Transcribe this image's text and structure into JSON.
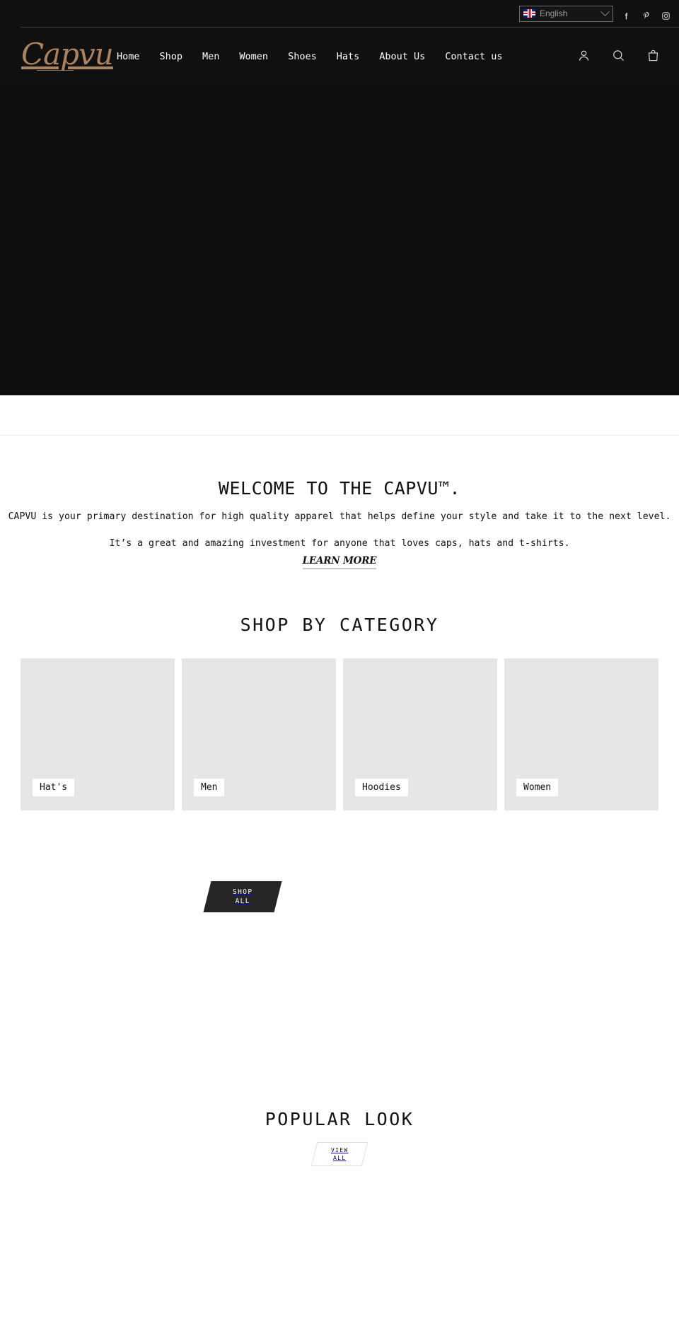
{
  "topbar": {
    "language": {
      "flag_icon": "uk-flag-icon",
      "value": "English",
      "chevron_icon": "chevron-down-icon"
    },
    "social": [
      {
        "name": "facebook-icon",
        "label": "Facebook"
      },
      {
        "name": "pinterest-icon",
        "label": "Pinterest"
      },
      {
        "name": "instagram-icon",
        "label": "Instagram"
      }
    ]
  },
  "header": {
    "logo_text": "Capvu",
    "nav": [
      {
        "label": "Home"
      },
      {
        "label": "Shop"
      },
      {
        "label": "Men"
      },
      {
        "label": "Women"
      },
      {
        "label": "Shoes"
      },
      {
        "label": "Hats"
      },
      {
        "label": "About Us"
      },
      {
        "label": "Contact us"
      }
    ],
    "icons": [
      {
        "name": "account-icon",
        "label": "Log in"
      },
      {
        "name": "search-icon",
        "label": "Search"
      },
      {
        "name": "cart-icon",
        "label": "Cart"
      }
    ]
  },
  "welcome": {
    "heading": "WELCOME TO THE CAPVU™.",
    "paragraph_line1": "CAPVU is your primary destination for high quality apparel that helps define your style and take it to the next level.",
    "paragraph_line2": "It’s a great and amazing investment for anyone that loves caps, hats and t-shirts.",
    "link_label": "LEARN MORE"
  },
  "category": {
    "heading": "SHOP BY CATEGORY",
    "cards": [
      {
        "label": "Hat's"
      },
      {
        "label": "Men"
      },
      {
        "label": "Hoodies"
      },
      {
        "label": "Women"
      }
    ],
    "shop_all_line1": "SHOP",
    "shop_all_line2": "ALL"
  },
  "popular": {
    "heading": "POPULAR LOOK",
    "view_all_line1": "VIEW",
    "view_all_line2": "ALL"
  },
  "colors": {
    "dark": "#101010",
    "logo_bronze": "#ab8361",
    "card_placeholder": "#e6e6e6",
    "button_dark": "#262626"
  }
}
